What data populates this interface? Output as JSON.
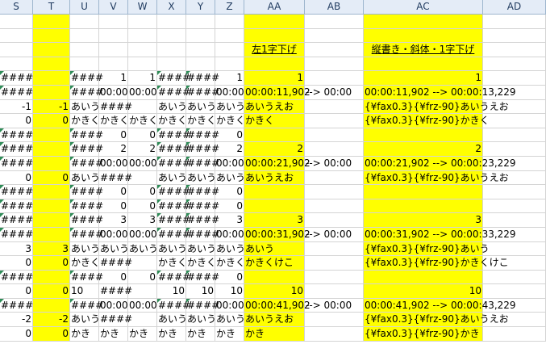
{
  "columns": [
    "S",
    "T",
    "U",
    "V",
    "W",
    "X",
    "Y",
    "Z",
    "AA",
    "AB",
    "AC",
    "AD"
  ],
  "headings": {
    "aa": "左1字下げ",
    "ac": "縦書き・斜体・1字下げ"
  },
  "rows": [
    [
      "",
      "",
      "",
      "",
      "",
      "",
      "",
      "",
      "",
      "",
      "",
      ""
    ],
    [
      "",
      "",
      "",
      "",
      "",
      "",
      "",
      "",
      "",
      "",
      "",
      ""
    ],
    [
      "",
      "",
      "",
      "",
      "",
      "",
      "",
      "",
      "左1字下げ",
      "",
      "縦書き・斜体・1字下げ",
      ""
    ],
    [
      "",
      "",
      "",
      "",
      "",
      "",
      "",
      "",
      "",
      "",
      "",
      ""
    ],
    [
      "####",
      "",
      "####",
      "1",
      "1",
      "####",
      "####",
      "1",
      "1",
      "",
      "1",
      ""
    ],
    [
      "####",
      "",
      "####",
      "00:00",
      "00:00",
      "####",
      "####",
      "00:00",
      "00:00:11,902",
      " --> 00:00",
      "00:00:11,902 --> 00:00:13,229",
      ""
    ],
    [
      "-1",
      "-1",
      "あいう",
      "####",
      "",
      "あいう",
      "あいう",
      "あいう",
      "あいうえお",
      "",
      "{¥fax0.3}{¥frz-90}あいうえお",
      ""
    ],
    [
      "0",
      "0",
      "かきく",
      "かきく",
      "かきく",
      "かきく",
      "かきく",
      "かきく",
      "かきく",
      "",
      "{¥fax0.3}{¥frz-90}かきく",
      ""
    ],
    [
      "####",
      "",
      "####",
      "0",
      "0",
      "####",
      "####",
      "0",
      "",
      "",
      "",
      ""
    ],
    [
      "####",
      "",
      "####",
      "2",
      "2",
      "####",
      "####",
      "2",
      "2",
      "",
      "2",
      ""
    ],
    [
      "####",
      "",
      "####",
      "00:00",
      "00:00",
      "####",
      "####",
      "00:00",
      "00:00:21,902",
      " --> 00:00",
      "00:00:21,902 --> 00:00:23,229",
      ""
    ],
    [
      "0",
      "0",
      "あいう",
      "####",
      "",
      "あいう",
      "あいう",
      "あいう",
      "あいうえお",
      "",
      "{¥fax0.3}{¥frz-90}あいうえお",
      ""
    ],
    [
      "####",
      "",
      "####",
      "0",
      "0",
      "####",
      "####",
      "0",
      "",
      "",
      "",
      ""
    ],
    [
      "####",
      "",
      "####",
      "0",
      "0",
      "####",
      "####",
      "0",
      "",
      "",
      "",
      ""
    ],
    [
      "####",
      "",
      "####",
      "3",
      "3",
      "####",
      "####",
      "3",
      "3",
      "",
      "3",
      ""
    ],
    [
      "####",
      "",
      "####",
      "00:00",
      "00:00",
      "####",
      "####",
      "00:00",
      "00:00:31,902",
      " --> 00:00",
      "00:00:31,902 --> 00:00:33,229",
      ""
    ],
    [
      "3",
      "3",
      "あいう",
      "あいう",
      "あいう",
      "あいう",
      "あいう",
      "あいう",
      "あいう",
      "",
      "{¥fax0.3}{¥frz-90}あいう",
      ""
    ],
    [
      "0",
      "0",
      "かきく",
      "####",
      "",
      "かきく",
      "かきく",
      "かきく",
      "かきくけこ",
      "",
      "{¥fax0.3}{¥frz-90}かきくけこ",
      ""
    ],
    [
      "####",
      "",
      "####",
      "0",
      "0",
      "####",
      "####",
      "0",
      "",
      "",
      "",
      ""
    ],
    [
      "0",
      "0",
      "10",
      "####",
      "",
      "10",
      "10",
      "10",
      "10",
      "",
      "10",
      ""
    ],
    [
      "####",
      "",
      "####",
      "00:00",
      "00:00",
      "####",
      "####",
      "00:00",
      "00:00:41,902",
      " --> 00:00",
      "00:00:41,902 --> 00:00:43,229",
      ""
    ],
    [
      "-2",
      "-2",
      "あいう",
      "####",
      "",
      "あいう",
      "あいう",
      "あいう",
      "あいうえお",
      "",
      "{¥fax0.3}{¥frz-90}あいうえお",
      ""
    ],
    [
      "0",
      "0",
      "かき",
      "かき",
      "かき",
      "かき",
      "かき",
      "かき",
      "かき",
      "",
      "{¥fax0.3}{¥frz-90}かき",
      ""
    ]
  ],
  "colors": {
    "highlight": "#ffff00",
    "header_bg": "#e4ecf7",
    "gridline": "#d4d4d4",
    "error_marker": "#2e8b57"
  }
}
